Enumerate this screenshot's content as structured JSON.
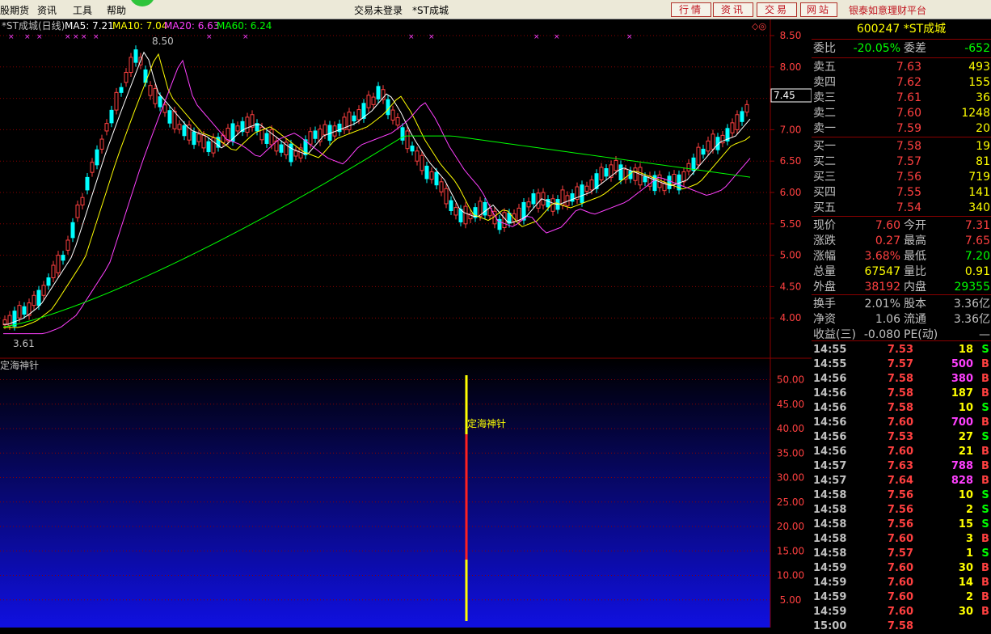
{
  "menu": {
    "items": [
      "股期货",
      "资讯",
      "工具",
      "帮助"
    ]
  },
  "status": {
    "login": "交易未登录",
    "stock": "*ST成城"
  },
  "nav": {
    "buttons": [
      "行情",
      "资讯",
      "交易",
      "网站"
    ]
  },
  "ad": {
    "text": "银泰如意理财平台"
  },
  "colors": {
    "up": "#ff4040",
    "down": "#00ffff",
    "ma5": "#ffffff",
    "ma10": "#ffff00",
    "ma20": "#ff40ff",
    "ma60": "#00ff00",
    "grid": "#8b0000",
    "indicator": "#ffff00"
  },
  "chart": {
    "legend": {
      "name": "*ST成城(日线)",
      "ma5": "MA5: 7.21",
      "ma10": "MA10: 7.04",
      "ma20": "MA20: 6.63",
      "ma60": "MA60: 6.24"
    },
    "high_label": "8.50",
    "low_label": "3.61",
    "price_tag": "7.45",
    "yticks": [
      "8.50",
      "8.00",
      "7.50",
      "7.00",
      "6.50",
      "6.00",
      "5.50",
      "5.00",
      "4.50",
      "4.00"
    ],
    "indicator": {
      "name": "定海神针",
      "label": "定海神针",
      "yticks": [
        "50.00",
        "45.00",
        "40.00",
        "35.00",
        "30.00",
        "25.00",
        "20.00",
        "15.00",
        "10.00",
        "5.00"
      ]
    }
  },
  "chart_data": [
    {
      "type": "candlestick",
      "title": "*ST成城(日线)",
      "yaxis_ticks": [
        4.0,
        4.5,
        5.0,
        5.5,
        6.0,
        6.5,
        7.0,
        7.5,
        8.0,
        8.5
      ],
      "ylim": [
        3.5,
        8.6
      ],
      "high": 8.5,
      "low": 3.61,
      "last_marker": 7.45,
      "ma": {
        "MA5": 7.21,
        "MA10": 7.04,
        "MA20": 6.63,
        "MA60": 6.24
      }
    },
    {
      "type": "bar",
      "title": "定海神针",
      "yaxis_ticks": [
        5,
        10,
        15,
        20,
        25,
        30,
        35,
        40,
        45,
        50
      ],
      "ylim": [
        0,
        52
      ]
    }
  ],
  "quote": {
    "code": "600247",
    "name": "*ST成城",
    "weibi": {
      "label": "委比",
      "value": "-20.05%"
    },
    "weicha": {
      "label": "委差",
      "value": "-652"
    },
    "asks": [
      {
        "label": "卖五",
        "price": "7.63",
        "vol": "493"
      },
      {
        "label": "卖四",
        "price": "7.62",
        "vol": "155"
      },
      {
        "label": "卖三",
        "price": "7.61",
        "vol": "36"
      },
      {
        "label": "卖二",
        "price": "7.60",
        "vol": "1248"
      },
      {
        "label": "卖一",
        "price": "7.59",
        "vol": "20"
      }
    ],
    "bids": [
      {
        "label": "买一",
        "price": "7.58",
        "vol": "19"
      },
      {
        "label": "买二",
        "price": "7.57",
        "vol": "81"
      },
      {
        "label": "买三",
        "price": "7.56",
        "vol": "719"
      },
      {
        "label": "买四",
        "price": "7.55",
        "vol": "141"
      },
      {
        "label": "买五",
        "price": "7.54",
        "vol": "340"
      }
    ],
    "stats": [
      {
        "l1": "现价",
        "v1": "7.60",
        "l2": "今开",
        "v2": "7.31"
      },
      {
        "l1": "涨跌",
        "v1": "0.27",
        "l2": "最高",
        "v2": "7.65"
      },
      {
        "l1": "涨幅",
        "v1": "3.68%",
        "l2": "最低",
        "v2": "7.20"
      },
      {
        "l1": "总量",
        "v1": "67547",
        "l2": "量比",
        "v2": "0.91"
      },
      {
        "l1": "外盘",
        "v1": "38192",
        "l2": "内盘",
        "v2": "29355"
      }
    ],
    "stats2": [
      {
        "l1": "换手",
        "v1": "2.01%",
        "l2": "股本",
        "v2": "3.36亿"
      },
      {
        "l1": "净资",
        "v1": "1.06",
        "l2": "流通",
        "v2": "3.36亿"
      },
      {
        "l1": "收益(三)",
        "v1": "-0.080",
        "l2": "PE(动)",
        "v2": "—"
      }
    ]
  },
  "ticks": [
    {
      "time": "14:55",
      "price": "7.53",
      "vol": "18",
      "side": "S"
    },
    {
      "time": "14:55",
      "price": "7.57",
      "vol": "500",
      "side": "B"
    },
    {
      "time": "14:56",
      "price": "7.58",
      "vol": "380",
      "side": "B"
    },
    {
      "time": "14:56",
      "price": "7.58",
      "vol": "187",
      "side": "B"
    },
    {
      "time": "14:56",
      "price": "7.58",
      "vol": "10",
      "side": "S"
    },
    {
      "time": "14:56",
      "price": "7.60",
      "vol": "700",
      "side": "B"
    },
    {
      "time": "14:56",
      "price": "7.53",
      "vol": "27",
      "side": "S"
    },
    {
      "time": "14:56",
      "price": "7.60",
      "vol": "21",
      "side": "B"
    },
    {
      "time": "14:57",
      "price": "7.63",
      "vol": "788",
      "side": "B"
    },
    {
      "time": "14:57",
      "price": "7.64",
      "vol": "828",
      "side": "B"
    },
    {
      "time": "14:58",
      "price": "7.56",
      "vol": "10",
      "side": "S"
    },
    {
      "time": "14:58",
      "price": "7.56",
      "vol": "2",
      "side": "S"
    },
    {
      "time": "14:58",
      "price": "7.56",
      "vol": "15",
      "side": "S"
    },
    {
      "time": "14:58",
      "price": "7.60",
      "vol": "3",
      "side": "B"
    },
    {
      "time": "14:58",
      "price": "7.57",
      "vol": "1",
      "side": "S"
    },
    {
      "time": "14:59",
      "price": "7.60",
      "vol": "30",
      "side": "B"
    },
    {
      "time": "14:59",
      "price": "7.60",
      "vol": "14",
      "side": "B"
    },
    {
      "time": "14:59",
      "price": "7.60",
      "vol": "2",
      "side": "B"
    },
    {
      "time": "14:59",
      "price": "7.60",
      "vol": "30",
      "side": "B"
    },
    {
      "time": "15:00",
      "price": "7.58",
      "vol": "",
      "side": ""
    }
  ]
}
